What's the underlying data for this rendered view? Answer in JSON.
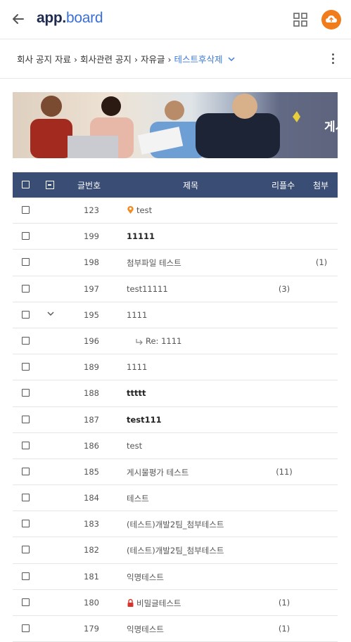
{
  "header": {
    "app_name_bold": "app.",
    "app_name_light": "board"
  },
  "breadcrumb": {
    "items": [
      "회사 공지 자료",
      "회사관련 공지",
      "자유글"
    ],
    "current": "테스트후삭제"
  },
  "banner": {
    "text": "게시판"
  },
  "table": {
    "columns": {
      "number": "글번호",
      "title": "제목",
      "replies": "리플수",
      "attach": "첨부"
    },
    "rows": [
      {
        "number": "123",
        "title": "test",
        "replies": "",
        "attach": "",
        "bold": false,
        "icon": "pin-icon",
        "reply": false,
        "toggle": false
      },
      {
        "number": "199",
        "title": "11111",
        "replies": "",
        "attach": "",
        "bold": true,
        "icon": "",
        "reply": false,
        "toggle": false
      },
      {
        "number": "198",
        "title": "첨부파일 테스트",
        "replies": "",
        "attach": "(1)",
        "bold": false,
        "icon": "",
        "reply": false,
        "toggle": false
      },
      {
        "number": "197",
        "title": "test11111",
        "replies": "(3)",
        "attach": "",
        "bold": false,
        "icon": "",
        "reply": false,
        "toggle": false
      },
      {
        "number": "195",
        "title": "1111",
        "replies": "",
        "attach": "",
        "bold": false,
        "icon": "",
        "reply": false,
        "toggle": true
      },
      {
        "number": "196",
        "title": "Re: 1111",
        "replies": "",
        "attach": "",
        "bold": false,
        "icon": "",
        "reply": true,
        "toggle": false
      },
      {
        "number": "189",
        "title": "1111",
        "replies": "",
        "attach": "",
        "bold": false,
        "icon": "",
        "reply": false,
        "toggle": false
      },
      {
        "number": "188",
        "title": "ttttt",
        "replies": "",
        "attach": "",
        "bold": true,
        "icon": "",
        "reply": false,
        "toggle": false
      },
      {
        "number": "187",
        "title": "test111",
        "replies": "",
        "attach": "",
        "bold": true,
        "icon": "",
        "reply": false,
        "toggle": false
      },
      {
        "number": "186",
        "title": "test",
        "replies": "",
        "attach": "",
        "bold": false,
        "icon": "",
        "reply": false,
        "toggle": false
      },
      {
        "number": "185",
        "title": "게시물평가 테스트",
        "replies": "(11)",
        "attach": "",
        "bold": false,
        "icon": "",
        "reply": false,
        "toggle": false
      },
      {
        "number": "184",
        "title": "테스트",
        "replies": "",
        "attach": "",
        "bold": false,
        "icon": "",
        "reply": false,
        "toggle": false
      },
      {
        "number": "183",
        "title": "(테스트)개발2팀_첨부테스트",
        "replies": "",
        "attach": "",
        "bold": false,
        "icon": "",
        "reply": false,
        "toggle": false
      },
      {
        "number": "182",
        "title": "(테스트)개발2팀_첨부테스트",
        "replies": "",
        "attach": "",
        "bold": false,
        "icon": "",
        "reply": false,
        "toggle": false
      },
      {
        "number": "181",
        "title": "익명테스트",
        "replies": "",
        "attach": "",
        "bold": false,
        "icon": "",
        "reply": false,
        "toggle": false
      },
      {
        "number": "180",
        "title": "비밀글테스트",
        "replies": "(1)",
        "attach": "",
        "bold": false,
        "icon": "lock-icon",
        "reply": false,
        "toggle": false
      },
      {
        "number": "179",
        "title": "익명테스트",
        "replies": "(1)",
        "attach": "",
        "bold": false,
        "icon": "",
        "reply": false,
        "toggle": false
      }
    ]
  },
  "colors": {
    "brand": "#1e2b4f",
    "accent": "#3d7bd9",
    "header_bg": "#3a4d74",
    "avatar": "#f07c1c"
  }
}
